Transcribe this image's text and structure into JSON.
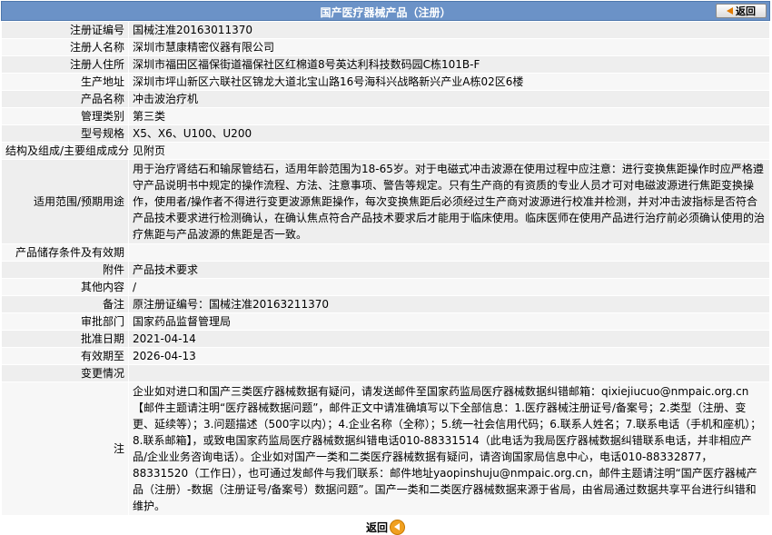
{
  "header": {
    "title": "国产医疗器械产品（注册）",
    "back_label": "返回"
  },
  "fields": [
    {
      "label": "注册证编号",
      "value": "国械注准20163011370"
    },
    {
      "label": "注册人名称",
      "value": "深圳市慧康精密仪器有限公司"
    },
    {
      "label": "注册人住所",
      "value": "深圳市福田区福保街道福保社区红棉道8号英达利科技数码园C栋101B-F"
    },
    {
      "label": "生产地址",
      "value": "深圳市坪山新区六联社区锦龙大道北宝山路16号海科兴战略新兴产业A栋02区6楼"
    },
    {
      "label": "产品名称",
      "value": "冲击波治疗机"
    },
    {
      "label": "管理类别",
      "value": "第三类"
    },
    {
      "label": "型号规格",
      "value": "X5、X6、U100、U200"
    },
    {
      "label": "结构及组成/主要组成成分",
      "value": "见附页"
    },
    {
      "label": "适用范围/预期用途",
      "value": "用于治疗肾结石和输尿管结石，适用年龄范围为18-65岁。对于电磁式冲击波源在使用过程中应注意：进行变换焦距操作时应严格遵守产品说明书中规定的操作流程、方法、注意事项、警告等规定。只有生产商的有资质的专业人员才可对电磁波源进行焦距变换操作，使用者/操作者不得进行变更波源焦距操作，每次变换焦距后必须经过生产商对波源进行校准并检测，并对冲击波指标是否符合产品技术要求进行检测确认，在确认焦点符合产品技术要求后才能用于临床使用。临床医师在使用产品进行治疗前必须确认使用的治疗焦距与产品波源的焦距是否一致。"
    },
    {
      "label": "产品储存条件及有效期",
      "value": ""
    },
    {
      "label": "附件",
      "value": "产品技术要求"
    },
    {
      "label": "其他内容",
      "value": "/"
    },
    {
      "label": "备注",
      "value": "原注册证编号：国械注准20163211370"
    },
    {
      "label": "审批部门",
      "value": "国家药品监督管理局"
    },
    {
      "label": "批准日期",
      "value": "2021-04-14"
    },
    {
      "label": "有效期至",
      "value": "2026-04-13"
    },
    {
      "label": "变更情况",
      "value": ""
    },
    {
      "label": "注",
      "value": "企业如对进口和国产三类医疗器械数据有疑问，请发送邮件至国家药监局医疗器械数据纠错邮箱：qixiejiucuo@nmpaic.org.cn【邮件主题请注明“医疗器械数据问题”，邮件正文中请准确填写以下全部信息：1.医疗器械注册证号/备案号；2.类型（注册、变更、延续等）；3.问题描述（500字以内）；4.企业名称（全称）；5.统一社会信用代码；6.联系人姓名；7.联系电话（手机和座机）；8.联系邮箱】，或致电国家药监局医疗器械数据纠错电话010-88331514（此电话为我局医疗器械数据纠错联系电话，并非相应产品/企业业务咨询电话）。企业如对国产一类和二类医疗器械数据有疑问，请咨询国家局信息中心，电话010-88332877，88331520（工作日），也可通过发邮件与我们联系：邮件地址yaopinshuju@nmpaic.org.cn，邮件主题请注明“国产医疗器械产品（注册）-数据（注册证号/备案号）数据问题”。国产一类和二类医疗器械数据来源于省局，由省局通过数据共享平台进行纠错和维护。"
    }
  ],
  "footer": {
    "back_label": "返回"
  },
  "colors": {
    "title_bar": "#6b92c7",
    "row_odd": "#eeeeee",
    "row_even": "#f7f7f7",
    "back_icon": "#f0a020"
  }
}
